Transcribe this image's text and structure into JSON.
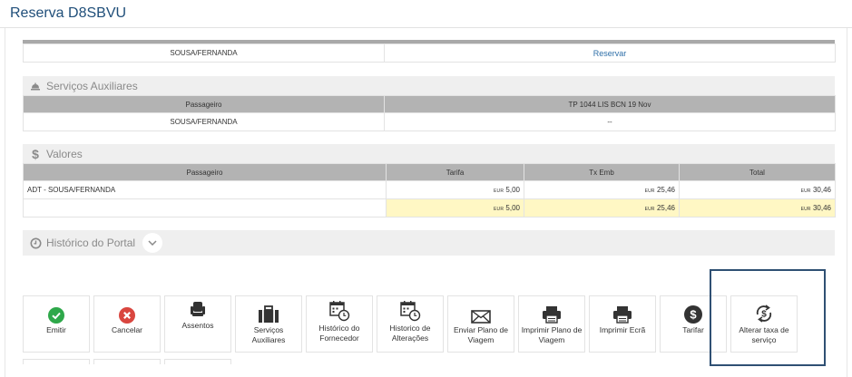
{
  "page": {
    "title": "Reserva D8SBVU"
  },
  "reservation_row": {
    "passenger": "SOUSA/FERNANDA",
    "action_link": "Reservar"
  },
  "aux_services": {
    "title": "Serviços Auxiliares",
    "headers": [
      "Passageiro",
      "TP 1044 LIS BCN 19 Nov"
    ],
    "row": {
      "passenger": "SOUSA/FERNANDA",
      "value": "--"
    }
  },
  "values": {
    "title": "Valores",
    "headers": [
      "Passageiro",
      "Tarifa",
      "Tx Emb",
      "Total"
    ],
    "currency": "EUR",
    "row": {
      "passenger": "ADT - SOUSA/FERNANDA",
      "tarifa": "5,00",
      "tx_emb": "25,46",
      "total": "30,46"
    },
    "totals": {
      "tarifa": "5,00",
      "tx_emb": "25,46",
      "total": "30,46"
    }
  },
  "history": {
    "title": "Histórico do Portal"
  },
  "actions": [
    {
      "id": "emitir",
      "label": "Emitir",
      "icon": "check-circle-icon",
      "color": "#2ea84a"
    },
    {
      "id": "cancelar",
      "label": "Cancelar",
      "icon": "close-circle-icon",
      "color": "#d9463f"
    },
    {
      "id": "assentos",
      "label": "Assentos",
      "icon": "seat-icon",
      "color": "#333333"
    },
    {
      "id": "servicos-auxiliares",
      "label": "Serviços Auxiliares",
      "icon": "suitcase-icon",
      "color": "#333333"
    },
    {
      "id": "historico-fornecedor",
      "label": "Histórico do Fornecedor",
      "icon": "calendar-clock-icon",
      "color": "#333333"
    },
    {
      "id": "historico-alteracoes",
      "label": "Historico de Alterações",
      "icon": "calendar-clock-icon",
      "color": "#333333"
    },
    {
      "id": "enviar-plano",
      "label": "Enviar Plano de Viagem",
      "icon": "envelope-icon",
      "color": "#333333"
    },
    {
      "id": "imprimir-plano",
      "label": "Imprimir Plano de Viagem",
      "icon": "printer-icon",
      "color": "#333333"
    },
    {
      "id": "imprimir-ecra",
      "label": "Imprimir Ecrã",
      "icon": "printer-icon",
      "color": "#333333"
    },
    {
      "id": "tarifar",
      "label": "Tarifar",
      "icon": "dollar-circle-icon",
      "color": "#333333"
    },
    {
      "id": "alterar-taxa",
      "label": "Alterar taxa de serviço",
      "icon": "dollar-refresh-icon",
      "color": "#333333"
    }
  ]
}
